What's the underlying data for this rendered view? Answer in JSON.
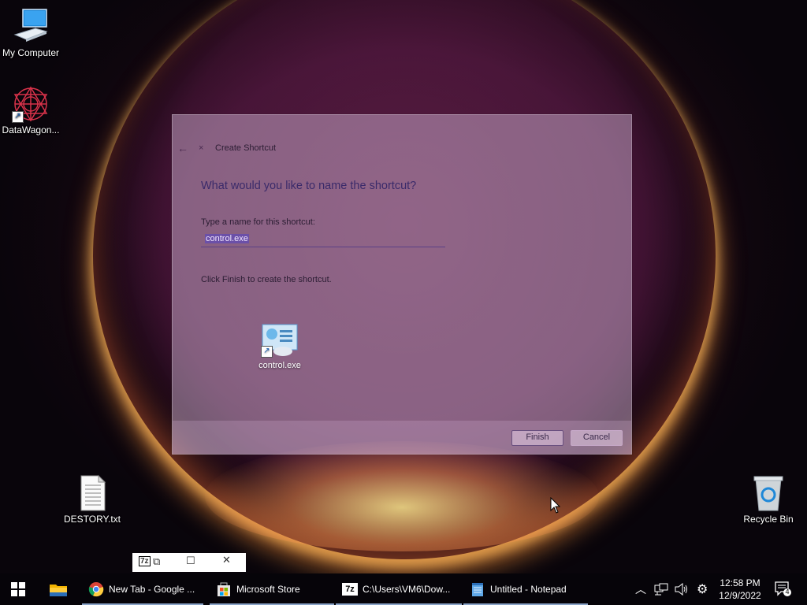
{
  "desktop": {
    "icons": [
      {
        "label": "My Computer"
      },
      {
        "label": "DataWagon..."
      },
      {
        "label": "DESTORY.txt"
      },
      {
        "label": "Recycle Bin"
      }
    ]
  },
  "dialog": {
    "title": "Create Shortcut",
    "heading": "What would you like to name the shortcut?",
    "name_label": "Type a name for this shortcut:",
    "name_value": "control.exe",
    "finish_note": "Click Finish to create the shortcut.",
    "file_icon_label": "control.exe",
    "finish_button": "Finish",
    "cancel_button": "Cancel"
  },
  "mini_preview": {
    "app_badge": "7z"
  },
  "taskbar": {
    "items": [
      {
        "label": "New Tab - Google ..."
      },
      {
        "label": "Microsoft Store"
      },
      {
        "label": "C:\\Users\\VM6\\Dow..."
      },
      {
        "label": "Untitled - Notepad"
      }
    ],
    "seven_zip_badge": "7z",
    "clock_time": "12:58 PM",
    "clock_date": "12/9/2022",
    "notification_count": "4"
  },
  "colors": {
    "taskbar_bg": "#060409",
    "dialog_accent": "#5b3f86",
    "selection": "#6b50a8"
  }
}
